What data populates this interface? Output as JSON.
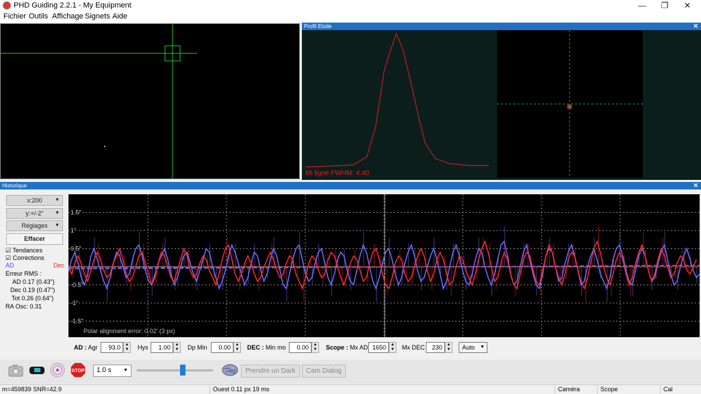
{
  "window": {
    "title": "PHD Guiding 2.2.1 - My Equipment",
    "minimize": "—",
    "maximize": "❐",
    "close": "✕"
  },
  "menu": [
    "Fichier",
    "Outils",
    "Affichage",
    "Signets",
    "Aide"
  ],
  "profile": {
    "title": "Profil Etoile",
    "fwhm_label": "Mi ligne FWHM: 4.40",
    "curve_color": "#e02020"
  },
  "history": {
    "title": "Historique",
    "x_scale": "x:200",
    "y_scale": "y:+/-2\"",
    "settings": "Réglages",
    "clear": "Effacer",
    "trends_label": "Tendances",
    "trends_checked": true,
    "corrections_label": "Corrections",
    "corrections_checked": true,
    "ra_label": "AD",
    "dec_label": "Dec",
    "rms_header": "Erreur RMS :",
    "rms_ra": "AD 0.17 (0.43\")",
    "rms_dec": "Dec 0.19 (0.47\")",
    "rms_tot": "Tot 0.26 (0.64\")",
    "ra_osc": "RA Osc: 0.31",
    "polar_error": "Polar alignment error: 0.02' (3 px)",
    "ra_color": "#6f6fff",
    "dec_color": "#ff2a2a"
  },
  "params": {
    "ad_title": "AD :",
    "agr_label": "Agr",
    "agr_value": "93.0",
    "hys_label": "Hys",
    "hys_value": "1.00",
    "dpmin_label": "Dp Min",
    "dpmin_value": "0.00",
    "dec_title": "DEC :",
    "minmo_label": "Min mo",
    "minmo_value": "0.00",
    "scope_title": "Scope :",
    "mxad_label": "Mx AD",
    "mxad_value": "1650",
    "mxdec_label": "Mx DEC",
    "mxdec_value": "230",
    "mode_value": "Auto"
  },
  "toolbar": {
    "exposure": "1.0 s",
    "dark_button": "Prendre un Dark",
    "cam_dialog": "Cam Dialog",
    "stop": "STOP"
  },
  "status": {
    "left": "m=459839 SNR=42.9",
    "middle": "Ouest  0.11 px  19 ms",
    "camera": "Caméra",
    "scope": "Scope",
    "cal": "Cal"
  },
  "chart_data": {
    "type": "line",
    "ytick_labels": [
      "1.5\"",
      "1\"",
      "0.5\"",
      "-0.5\"",
      "-1\"",
      "-1.5\""
    ],
    "ytick_values": [
      1.5,
      1,
      0.5,
      -0.5,
      -1,
      -1.5
    ],
    "ylim": [
      -2,
      2
    ],
    "xlim": [
      0,
      200
    ],
    "series": [
      {
        "name": "AD",
        "values": [
          -0.1,
          0.2,
          0.4,
          0.1,
          -0.3,
          -0.5,
          -0.2,
          0.3,
          0.5,
          0.2,
          -0.1,
          -0.4,
          -0.6,
          -0.3,
          0.1,
          0.4,
          0.3,
          0.0,
          -0.3,
          -0.2,
          0.2,
          0.5,
          0.6,
          0.3,
          -0.1,
          -0.4,
          -0.5,
          -0.2,
          0.1,
          0.3,
          0.5,
          0.2,
          -0.2,
          -0.5,
          -0.3,
          0.0,
          0.3,
          0.4,
          0.1,
          -0.2,
          -0.4,
          -0.1,
          0.2,
          0.5,
          0.4,
          0.0,
          -0.3,
          -0.6,
          -0.4,
          -0.1,
          0.3,
          0.6,
          0.4,
          0.1,
          -0.2,
          -0.5,
          -0.3,
          0.1,
          0.4,
          0.3,
          -0.1,
          -0.4,
          -0.2,
          0.2,
          0.5,
          0.3,
          -0.1,
          -0.5,
          -0.6,
          -0.2,
          0.2,
          0.5,
          0.6,
          0.2,
          -0.2,
          -0.4,
          -0.3,
          0.1,
          0.4,
          0.5,
          0.1,
          -0.3,
          -0.5,
          -0.2,
          0.2,
          0.4,
          0.3,
          -0.1,
          -0.4,
          -0.5,
          -0.1,
          0.3,
          0.6,
          0.4,
          0.0,
          -0.4,
          -0.6,
          -0.3,
          0.1,
          0.4,
          0.5,
          0.2,
          -0.2,
          -0.5,
          -0.3,
          0.1,
          0.4,
          0.6,
          0.3,
          -0.1,
          -0.4,
          -0.3,
          0.0,
          0.3,
          0.5,
          0.2,
          -0.2,
          -0.6,
          -0.4,
          0.0,
          0.4,
          0.6,
          0.3,
          -0.1,
          -0.4,
          -0.5,
          -0.2,
          0.2,
          0.5,
          0.4,
          0.0,
          -0.3,
          -0.5,
          -0.2,
          0.2,
          0.6,
          0.7,
          0.3,
          -0.2,
          -0.5,
          -0.4,
          0.0,
          0.4,
          0.6,
          0.2,
          -0.2,
          -0.5,
          -0.6,
          -0.2,
          0.3,
          0.5,
          0.4,
          0.0,
          -0.4,
          -0.3,
          0.1,
          0.4,
          0.6,
          0.3,
          -0.1,
          -0.5,
          -0.4,
          0.0,
          0.3,
          0.5,
          0.2,
          -0.2,
          -0.4,
          -0.6,
          -0.3,
          0.2,
          0.5,
          0.6,
          0.3,
          -0.1,
          -0.4,
          -0.5,
          -0.1,
          0.3,
          0.5,
          0.3,
          -0.1,
          -0.4,
          -0.3,
          0.1,
          0.4,
          0.6,
          0.2,
          -0.2,
          -0.5,
          -0.4,
          0.0,
          0.3,
          0.5,
          0.2,
          -0.1,
          -0.3,
          -0.2
        ]
      },
      {
        "name": "Dec",
        "values": [
          0.0,
          -0.2,
          0.1,
          0.3,
          0.1,
          -0.2,
          -0.4,
          -0.1,
          0.2,
          0.4,
          0.2,
          -0.1,
          -0.3,
          -0.2,
          0.1,
          0.3,
          0.5,
          0.2,
          -0.2,
          -0.4,
          -0.3,
          0.0,
          0.3,
          0.4,
          0.1,
          -0.2,
          -0.5,
          -0.3,
          0.1,
          0.4,
          0.3,
          0.0,
          -0.3,
          -0.4,
          -0.1,
          0.2,
          0.5,
          0.3,
          -0.1,
          -0.3,
          -0.2,
          0.1,
          0.3,
          0.2,
          -0.1,
          -0.3,
          -0.5,
          -0.2,
          0.2,
          0.5,
          0.6,
          0.2,
          -0.2,
          -0.4,
          -0.2,
          0.1,
          0.3,
          0.1,
          -0.2,
          -0.4,
          -0.3,
          0.0,
          0.2,
          0.4,
          0.2,
          -0.1,
          -0.3,
          -0.2,
          0.1,
          0.3,
          0.2,
          -0.2,
          -0.4,
          -0.6,
          -0.3,
          0.1,
          0.3,
          0.2,
          -0.1,
          -0.3,
          -0.2,
          0.2,
          0.4,
          0.3,
          0.0,
          -0.3,
          -0.5,
          -0.2,
          0.1,
          0.3,
          0.2,
          -0.1,
          -0.4,
          -0.3,
          0.1,
          0.4,
          0.5,
          0.2,
          -0.2,
          -0.5,
          -0.6,
          -0.3,
          0.1,
          0.3,
          0.2,
          -0.2,
          -0.4,
          -0.3,
          0.0,
          0.3,
          0.5,
          0.3,
          -0.1,
          -0.4,
          -0.2,
          0.2,
          0.4,
          0.2,
          -0.2,
          -0.5,
          -0.4,
          0.0,
          0.3,
          0.2,
          -0.1,
          -0.3,
          -0.5,
          -0.2,
          0.2,
          0.5,
          0.7,
          0.4,
          0.0,
          -0.4,
          -0.3,
          0.1,
          0.4,
          0.2,
          -0.2,
          -0.5,
          -0.6,
          -0.2,
          0.2,
          0.4,
          0.3,
          -0.1,
          -0.4,
          -0.5,
          -0.1,
          0.3,
          0.6,
          0.4,
          0.0,
          -0.3,
          -0.5,
          -0.2,
          0.2,
          0.4,
          0.3,
          -0.1,
          -0.4,
          -0.6,
          -0.3,
          0.1,
          0.5,
          0.7,
          0.4,
          0.0,
          -0.3,
          -0.5,
          -0.2,
          0.2,
          0.4,
          0.2,
          -0.2,
          -0.5,
          -0.3,
          0.1,
          0.4,
          0.6,
          0.3,
          -0.1,
          -0.4,
          -0.2,
          0.2,
          0.5,
          0.3,
          0.0,
          -0.3,
          -0.2,
          0.1,
          0.3,
          0.2,
          -0.1,
          -0.2,
          0.0,
          0.2
        ]
      }
    ]
  }
}
